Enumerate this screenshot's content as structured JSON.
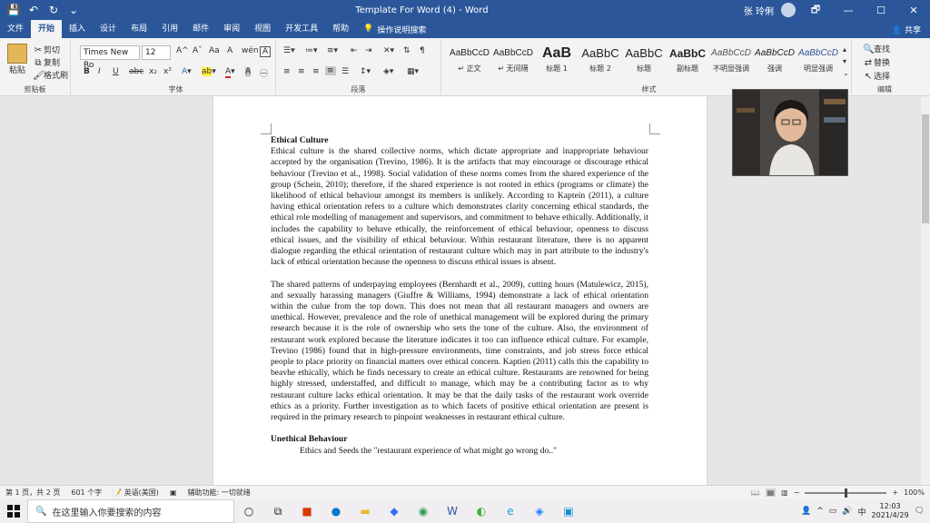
{
  "titlebar": {
    "title": "Template For Word  (4)  -  Word",
    "user": "张 玲俐",
    "buttons": {
      "restore": "🗗",
      "minimize": "—",
      "maximize": "☐",
      "close": "✕"
    },
    "qat": {
      "save": "💾",
      "undo": "↶",
      "redo": "↻",
      "more": "⌄"
    }
  },
  "tabs": [
    "文件",
    "开始",
    "插入",
    "设计",
    "布局",
    "引用",
    "邮件",
    "审阅",
    "视图",
    "开发工具",
    "帮助"
  ],
  "tell_me": "操作说明搜索",
  "share": "共享",
  "ribbon": {
    "clipboard": {
      "paste": "粘贴",
      "cut": "剪切",
      "copy": "复制",
      "format_painter": "格式刷",
      "label": "剪贴板"
    },
    "font": {
      "name": "Times New Ro",
      "size": "12",
      "label": "字体",
      "bold": "B",
      "italic": "I",
      "underline": "U",
      "strike": "abc",
      "sub": "x₂",
      "super": "x²",
      "grow": "A^",
      "shrink": "Aˇ",
      "case": "Aa",
      "clear": "A",
      "phonetic": "wén",
      "charborder": "A"
    },
    "paragraph": {
      "label": "段落"
    },
    "styles": {
      "label": "样式",
      "items": [
        {
          "sample": "AaBbCcD",
          "name": "↵ 正文"
        },
        {
          "sample": "AaBbCcD",
          "name": "↵ 无间隔"
        },
        {
          "sample": "AaB",
          "name": "标题 1"
        },
        {
          "sample": "AaBbC",
          "name": "标题 2"
        },
        {
          "sample": "AaBbC",
          "name": "标题"
        },
        {
          "sample": "AaBbC",
          "name": "副标题"
        },
        {
          "sample": "AaBbCcD",
          "name": "不明显强调"
        },
        {
          "sample": "AaBbCcD",
          "name": "强调"
        },
        {
          "sample": "AaBbCcD",
          "name": "明显强调"
        }
      ]
    },
    "editing": {
      "find": "查找",
      "replace": "替换",
      "select": "选择",
      "label": "编辑"
    }
  },
  "document": {
    "heading1": "Ethical Culture",
    "para1": "Ethical culture is the shared collective norms, which dictate appropriate and inappropriate behaviour accepted by the organisation (Trevino, 1986). It is the artifacts that may eincourage or discourage ethical behaviour (Trevino et al., 1998). Social validation of these norms comes from the shared experience of the group (Schein, 2010); therefore, if the shared experience is not rooted in ethics (programs or climate) the likelihood of ethical behaviour amongst its members is unlikely. According to Kaptein (2011), a culture having ethical orientation refers to a culture which demonstrates clarity concerning ethical standards, the ethical role modelling of management and supervisors, and commitment to behave ethically. Additionally, it includes the capability to behave ethically, the reinforcement of ethical behaviour, openness to discuss ethical issues, and the visibility of ethical behaviour. Within restaurant literature, there is no apparent dialogue regarding the ethical orientation of restaurant culture which may in part attribute to the industry's lack of ethical orientation because the openness to discuss ethical issues is absent.",
    "para2": "The shared patterns of underpaying employees (Bernhardt et al., 2009), cutting hours (Matulewicz, 2015), and sexually harassing managers (Giuffre & Williams, 1994) demonstrate a lack of ethical orientation within the culue from the top down. This does not mean that all restaurant managers and owners are unethical. However, prevalence and the role of unethical management will be explored during the primary research because it is the role of ownership who sets the tone of the culture. Also, the environment of restaurant work explored because the literature indicates it too can influence ethical culture. For example, Trevino (1986) found that in high-pressure environments, time constraints, and job stress force ethical people to place priority on financial matters over ethical concern. Kaptien (2011) calls this the capability to beavhe ethically, which he finds necessary to create an ethical culture. Restaurants are renowned for being highly stressed, understaffed, and difficult to manage, which may be a contributing factor as to why restaurant culture lacks ethical orientation. It may be that the daily tasks of the restaurant work override ethics as a priority. Further investigation as to which facets of positive ethical orientation are present is required in the primary research to pinpoint weaknesses in restaurant ethical culture.",
    "heading2": "Unethical Behaviour",
    "para3": "Ethics and Seeds the \"restaurant experience of what might go wrong do..\""
  },
  "statusbar": {
    "page": "第 1 页，共 2 页",
    "words": "601 个字",
    "lang": "英语(美国)",
    "accessibility": "辅助功能: 一切就绪",
    "zoom": "100%"
  },
  "taskbar": {
    "search_placeholder": "在这里输入你要搜索的内容",
    "time": "12:03",
    "date": "2021/4/29",
    "ime": "中"
  }
}
